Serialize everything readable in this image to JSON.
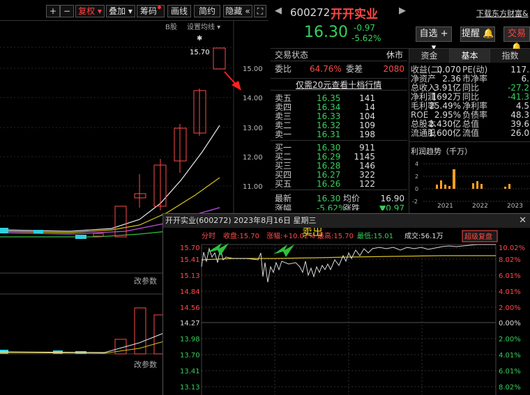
{
  "toolbar": {
    "plus": "+",
    "minus": "−",
    "fuquan": "复权 ▾",
    "diejia": "叠加 ▾",
    "chouma": "筹码",
    "huaxian": "画线",
    "jianyue": "简约",
    "yincang": "隐藏 «",
    "fullscreen_icon": "⛶"
  },
  "kchart": {
    "b_shares": "B股",
    "settings": "设置均线 ▾",
    "price_label": "15.70",
    "star": "✱",
    "axis": [
      "15.00",
      "14.00",
      "13.00",
      "12.00",
      "11.00"
    ],
    "param1": "改参数",
    "param2": "改参数"
  },
  "stock": {
    "prev_arrow": "◀",
    "next_arrow": "▶",
    "code": "600272",
    "name": "开开实业",
    "download": "下载东方财富&",
    "price": "16.30",
    "change": "-0.97",
    "change_pct": "-5.62%",
    "zixuan": "自选 + ▾",
    "tixing": "提醒 🔔",
    "jiaoyi": "交易 🔔"
  },
  "book": {
    "status_label": "交易状态",
    "status_value": "休市",
    "weibi_label": "委比",
    "weibi_value": "64.76%",
    "weicha_label": "委差",
    "weicha_value": "2080",
    "promo": "仅需20元查看十档行情",
    "sells": [
      {
        "label": "卖五",
        "price": "16.35",
        "vol": "141"
      },
      {
        "label": "卖四",
        "price": "16.34",
        "vol": "14"
      },
      {
        "label": "卖三",
        "price": "16.33",
        "vol": "104"
      },
      {
        "label": "卖二",
        "price": "16.32",
        "vol": "109"
      },
      {
        "label": "卖一",
        "price": "16.31",
        "vol": "198"
      }
    ],
    "buys": [
      {
        "label": "买一",
        "price": "16.30",
        "vol": "911"
      },
      {
        "label": "买二",
        "price": "16.29",
        "vol": "1145"
      },
      {
        "label": "买三",
        "price": "16.28",
        "vol": "146"
      },
      {
        "label": "买四",
        "price": "16.27",
        "vol": "322"
      },
      {
        "label": "买五",
        "price": "16.26",
        "vol": "122"
      }
    ],
    "latest_label": "最新",
    "latest_value": "16.30",
    "avg_label": "均价",
    "avg_value": "16.90",
    "zhangfu_label": "涨幅",
    "zhangfu_value": "-5.62%",
    "zhangdie_label": "涨跌",
    "zhangdie_value": "▼0.97"
  },
  "fin": {
    "tabs": [
      "资金",
      "基本",
      "指数"
    ],
    "rows": [
      {
        "k1": "收益(二)",
        "v1": "0.070",
        "k2": "PE(动)",
        "v2": "117."
      },
      {
        "k1": "净资产",
        "v1": "2.36",
        "k2": "市净率",
        "v2": "6."
      },
      {
        "k1": "总收入",
        "v1": "3.91亿",
        "k2": "同比",
        "v2": "-27.2"
      },
      {
        "k1": "净利润",
        "v1": "1692万",
        "k2": "同比",
        "v2": "-41.3"
      },
      {
        "k1": "毛利率",
        "v1": "25.49%",
        "k2": "净利率",
        "v2": "4.5"
      },
      {
        "k1": "ROE",
        "v1": "2.95%",
        "k2": "负债率",
        "v2": "48.3"
      },
      {
        "k1": "总股本",
        "v1": "2.430亿",
        "k2": "总值",
        "v2": "39.6"
      },
      {
        "k1": "流通股",
        "v1": "1.600亿",
        "k2": "流值",
        "v2": "26.0"
      }
    ],
    "trend_title": "利润趋势（千万）",
    "trend_axis": [
      "4",
      "2",
      "0",
      "-2"
    ],
    "years": [
      "2021",
      "2022",
      "2023"
    ]
  },
  "popup": {
    "title": "开开实业(600272)   2023年8月16日   星期三",
    "close": "✕",
    "fenshi": "分时",
    "shoupan": "收盘:15.70",
    "zhangfu": "涨幅:+10.02%",
    "zuigao": "最高:15.70",
    "zuidi": "最低:15.01",
    "chengjiao": "成交:56.1万",
    "super_btn": "超级复盘",
    "annotation": "卖出",
    "left_axis": [
      "15.70",
      "15.41",
      "15.13",
      "14.84",
      "14.56",
      "14.27",
      "13.98",
      "13.70",
      "13.41",
      "13.13"
    ],
    "right_axis": [
      "10.02%",
      "8.02%",
      "6.01%",
      "4.01%",
      "2.00%",
      "0.00%",
      "2.00%",
      "4.01%",
      "6.01%",
      "8.02%"
    ]
  },
  "colors": {
    "up": "#ff4a4a",
    "down": "#37d05a",
    "yellow": "#d8c020",
    "blue": "#4aa0ff"
  }
}
